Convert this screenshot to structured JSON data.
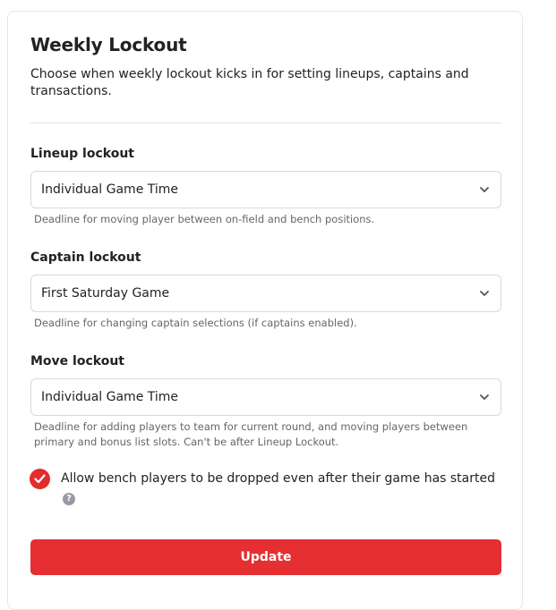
{
  "card": {
    "title": "Weekly Lockout",
    "description": "Choose when weekly lockout kicks in for setting lineups, captains and transactions."
  },
  "lineup": {
    "label": "Lineup lockout",
    "value": "Individual Game Time",
    "help": "Deadline for moving player between on-field and bench positions."
  },
  "captain": {
    "label": "Captain lockout",
    "value": "First Saturday Game",
    "help": "Deadline for changing captain selections (if captains enabled)."
  },
  "move": {
    "label": "Move lockout",
    "value": "Individual Game Time",
    "help": "Deadline for adding players to team for current round, and moving players between primary and bonus list slots. Can't be after Lineup Lockout."
  },
  "bench_drop": {
    "checked": true,
    "label": "Allow bench players to be dropped even after their game has started",
    "help_icon": "?"
  },
  "actions": {
    "update_label": "Update"
  },
  "colors": {
    "accent": "#e52f32",
    "check": "#e22d2d",
    "help_icon": "#9a9aa6"
  },
  "icons": {
    "select_chevron": "chevron-down-icon",
    "checkbox": "checkmark-icon",
    "help": "question-circle-icon"
  }
}
